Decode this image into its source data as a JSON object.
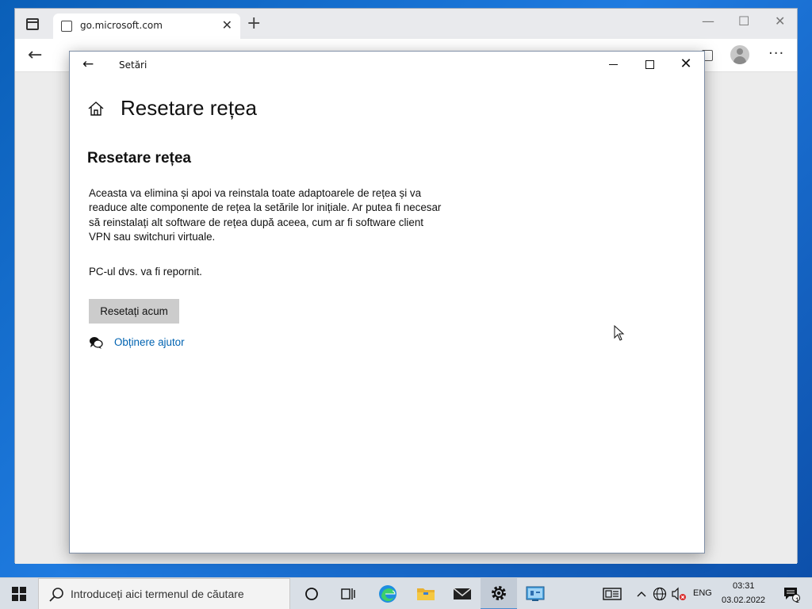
{
  "browser": {
    "tab_title": "go.microsoft.com",
    "tab_close": "✕",
    "new_tab": "+",
    "more_menu": "···"
  },
  "settings": {
    "window_title": "Setări",
    "page_title": "Resetare rețea",
    "section_title": "Resetare rețea",
    "description": "Aceasta va elimina și apoi va reinstala toate adaptoarele de rețea și va readuce alte componente de rețea la setările lor inițiale. Ar putea fi necesar să reinstalați alt software de rețea după aceea, cum ar fi software client VPN sau switchuri virtuale.",
    "restart_note": "PC-ul dvs. va fi repornit.",
    "reset_button": "Resetați acum",
    "help_link": "Obținere ajutor"
  },
  "taskbar": {
    "search_placeholder": "Introduceți aici termenul de căutare",
    "language": "ENG",
    "time": "03:31",
    "date": "03.02.2022",
    "notification_count": "1"
  },
  "colors": {
    "link": "#0063b1",
    "button_bg": "#cccccc",
    "taskbar_bg": "#d9dfe6"
  }
}
